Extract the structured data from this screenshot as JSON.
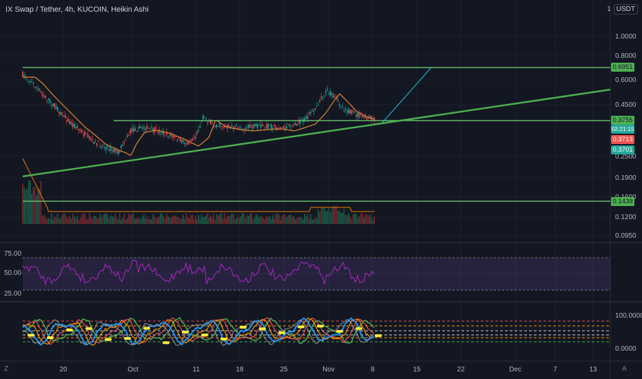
{
  "header": {
    "title": "IX Swap / Tether, 4h, KUCOIN, Heikin Ashi",
    "scale_mode": "1",
    "currency": "USDT"
  },
  "price_axis": {
    "labels": [
      "1.0000",
      "0.8000",
      "0.6000",
      "0.4500",
      "0.2500",
      "0.1900",
      "0.1600",
      "0.1200",
      "0.0950"
    ]
  },
  "price_tags": {
    "hline_top": "0.6951",
    "last_price": "0.3755",
    "countdown": "02:21:15",
    "tag_red": "0.3713",
    "tag_green": "0.3701",
    "hline_bottom": "0.1439"
  },
  "rsi_axis": {
    "labels": [
      "75.00",
      "50.00",
      "25.00"
    ]
  },
  "osc_axis": {
    "labels": [
      "100.0000",
      "0.0000"
    ]
  },
  "time_axis": {
    "labels": [
      "20",
      "Oct",
      "11",
      "18",
      "25",
      "Nov",
      "8",
      "15",
      "22",
      "Dec",
      "7",
      "13"
    ]
  },
  "corners": {
    "left": "Z",
    "right": "A"
  },
  "colors": {
    "background": "#131722",
    "up": "#26a69a",
    "down": "#ef5350",
    "trendline": "#4caf50",
    "rsi": "#9c27b0",
    "projection": "#00bcd4"
  }
}
